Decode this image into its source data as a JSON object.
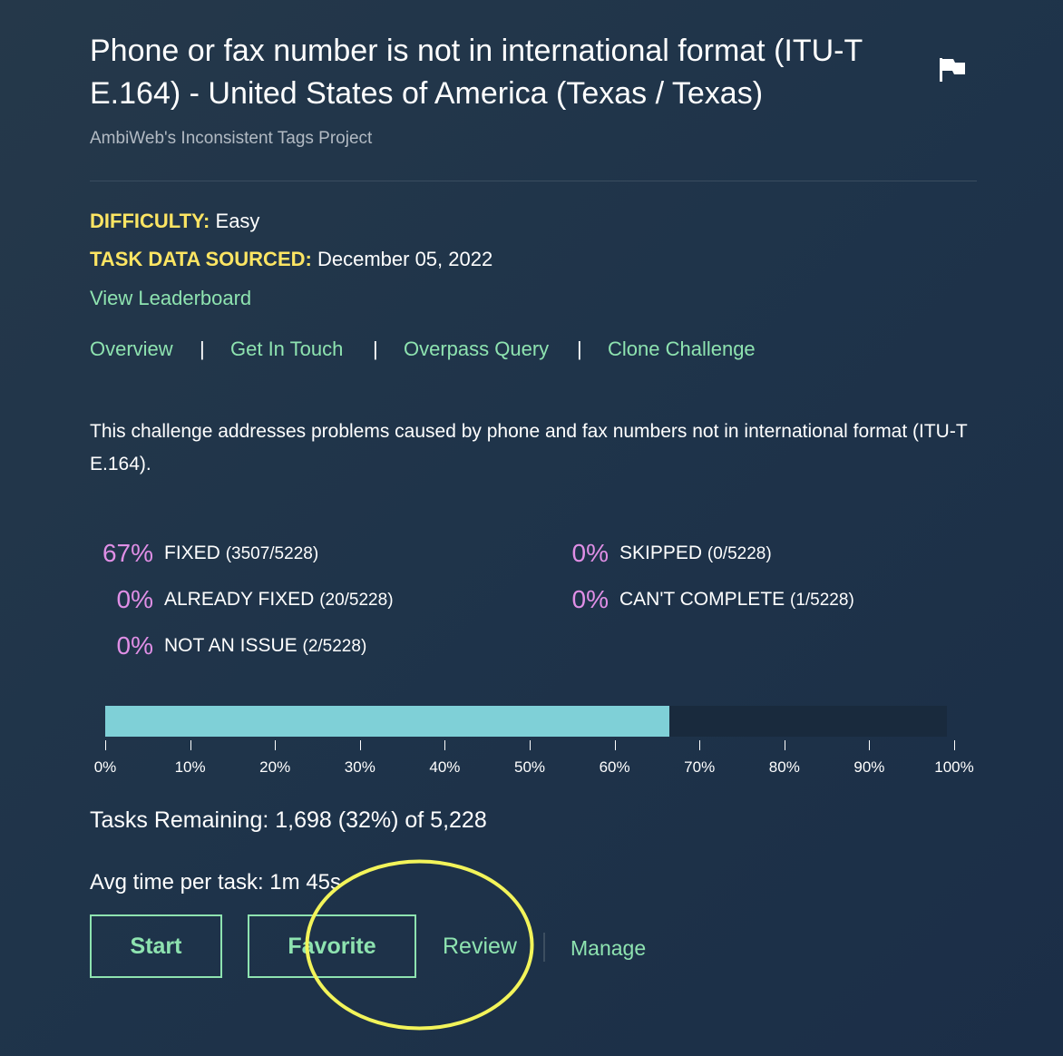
{
  "header": {
    "title": "Phone or fax number is not in international format (ITU-T E.164) - United States of America (Texas / Texas)",
    "project": "AmbiWeb's Inconsistent Tags Project",
    "flag_icon": "flag-icon"
  },
  "meta": {
    "difficulty_key": "DIFFICULTY:",
    "difficulty_value": "Easy",
    "sourced_key": "TASK DATA SOURCED:",
    "sourced_value": "December 05, 2022",
    "leaderboard_link": "View Leaderboard"
  },
  "tabs": [
    {
      "label": "Overview"
    },
    {
      "label": "Get In Touch"
    },
    {
      "label": "Overpass Query"
    },
    {
      "label": "Clone Challenge"
    }
  ],
  "tab_separator": "|",
  "description": "This challenge addresses problems caused by phone and fax numbers not in international format (ITU-T E.164).",
  "stats": [
    {
      "pct": "67%",
      "label": "FIXED",
      "count": "(3507/5228)"
    },
    {
      "pct": "0%",
      "label": "ALREADY FIXED",
      "count": "(20/5228)"
    },
    {
      "pct": "0%",
      "label": "NOT AN ISSUE",
      "count": "(2/5228)"
    },
    {
      "pct": "0%",
      "label": "SKIPPED",
      "count": "(0/5228)"
    },
    {
      "pct": "0%",
      "label": "CAN'T COMPLETE",
      "count": "(1/5228)"
    }
  ],
  "progress": {
    "value": 0.67,
    "ticks": [
      "0%",
      "10%",
      "20%",
      "30%",
      "40%",
      "50%",
      "60%",
      "70%",
      "80%",
      "90%",
      "100%"
    ]
  },
  "remaining_text": "Tasks Remaining: 1,698 (32%) of 5,228",
  "avg_time_text": "Avg time per task:  1m 45s",
  "actions": {
    "start": "Start",
    "favorite": "Favorite",
    "review": "Review",
    "manage": "Manage"
  },
  "colors": {
    "accent_green": "#8ee3b0",
    "label_yellow": "#fde563",
    "percent_pink": "#e08fe6",
    "bar_fill": "#7fd0d7",
    "highlight_yellow": "#f3f45a"
  }
}
